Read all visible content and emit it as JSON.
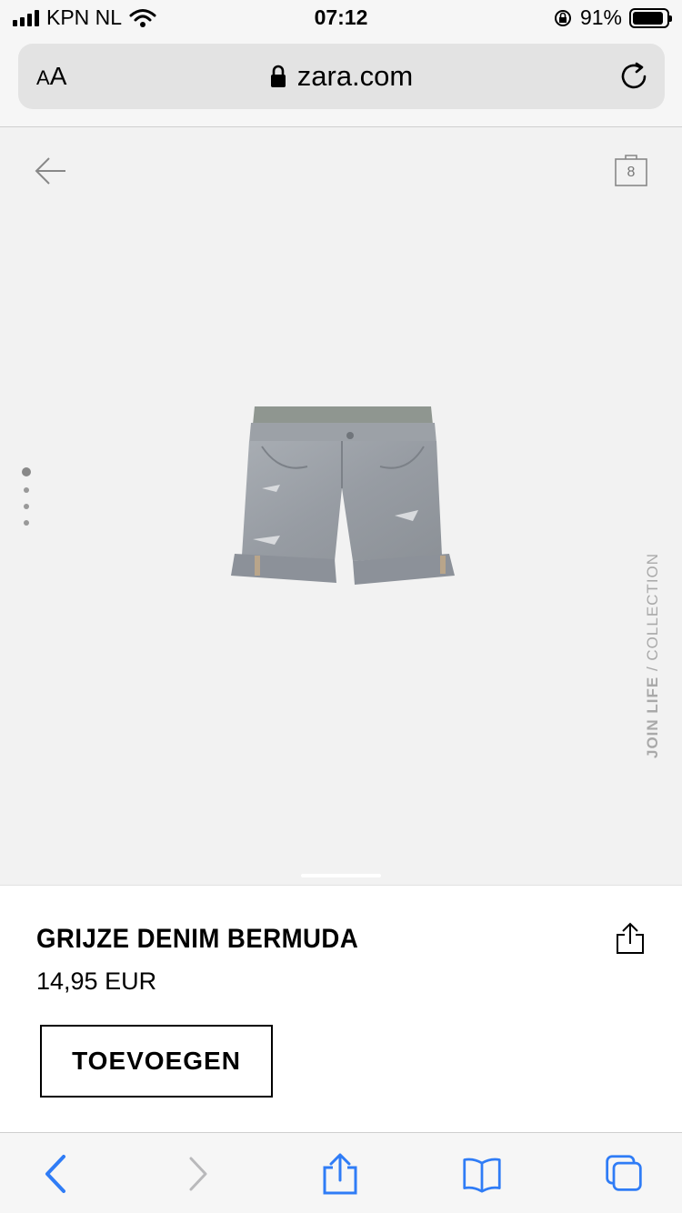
{
  "status_bar": {
    "carrier": "KPN NL",
    "time": "07:12",
    "battery_percent": "91%",
    "battery_level": 0.91
  },
  "browser": {
    "text_size_small": "A",
    "text_size_large": "A",
    "url": "zara.com"
  },
  "product_view": {
    "bag_count": "8",
    "image_count": 4,
    "active_image_index": 0,
    "vertical_label_strong": "JOIN LIFE",
    "vertical_label_rest": " / COLLECTION"
  },
  "product": {
    "title": "GRIJZE DENIM BERMUDA",
    "price": "14,95 EUR",
    "add_button_label": "TOEVOEGEN"
  },
  "colors": {
    "accent": "#2f7cf6",
    "disabled": "#b9b9bb"
  }
}
